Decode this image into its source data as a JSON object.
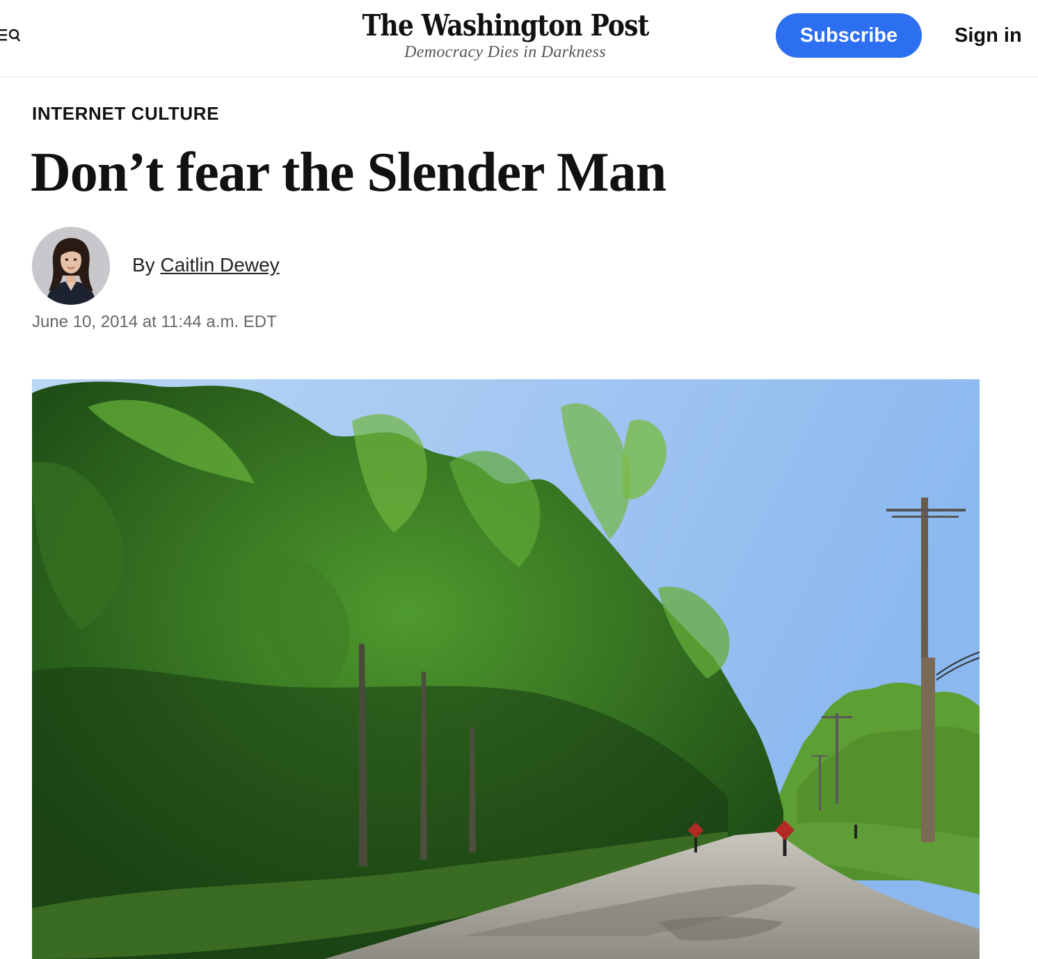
{
  "header": {
    "logo": "The Washington Post",
    "tagline": "Democracy Dies in Darkness",
    "subscribe_label": "Subscribe",
    "signin_label": "Sign in",
    "menu_icon": "menu-icon",
    "search_icon": "search-icon"
  },
  "article": {
    "kicker": "INTERNET CULTURE",
    "headline": "Don’t fear the Slender Man",
    "byline_prefix": "By",
    "author": "Caitlin Dewey",
    "timestamp": "June 10, 2014 at 11:44 a.m. EDT"
  },
  "colors": {
    "accent": "#2c6ff0",
    "text": "#111111",
    "muted": "#666666"
  }
}
